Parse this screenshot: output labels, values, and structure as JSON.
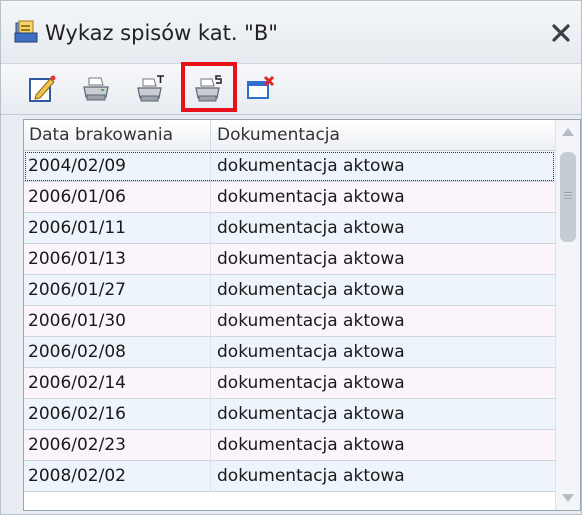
{
  "window": {
    "title": "Wykaz spisów kat. \"B\""
  },
  "toolbar": {
    "buttons": [
      {
        "icon": "edit-icon"
      },
      {
        "icon": "printer-icon"
      },
      {
        "icon": "print-t-icon"
      },
      {
        "icon": "print-s-icon",
        "highlighted": true
      },
      {
        "icon": "close-window-icon"
      }
    ],
    "highlight_color": "#e8111a"
  },
  "table": {
    "columns": [
      "Data brakowania",
      "Dokumentacja"
    ],
    "rows": [
      {
        "date": "2004/02/09",
        "doc": "dokumentacja aktowa"
      },
      {
        "date": "2006/01/06",
        "doc": "dokumentacja aktowa"
      },
      {
        "date": "2006/01/11",
        "doc": "dokumentacja aktowa"
      },
      {
        "date": "2006/01/13",
        "doc": "dokumentacja aktowa"
      },
      {
        "date": "2006/01/27",
        "doc": "dokumentacja aktowa"
      },
      {
        "date": "2006/01/30",
        "doc": "dokumentacja aktowa"
      },
      {
        "date": "2006/02/08",
        "doc": "dokumentacja aktowa"
      },
      {
        "date": "2006/02/14",
        "doc": "dokumentacja aktowa"
      },
      {
        "date": "2006/02/16",
        "doc": "dokumentacja aktowa"
      },
      {
        "date": "2006/02/23",
        "doc": "dokumentacja aktowa"
      },
      {
        "date": "2008/02/02",
        "doc": "dokumentacja aktowa"
      }
    ],
    "row_colors": {
      "odd": "#eef4fb",
      "even": "#fbf4fb"
    }
  }
}
